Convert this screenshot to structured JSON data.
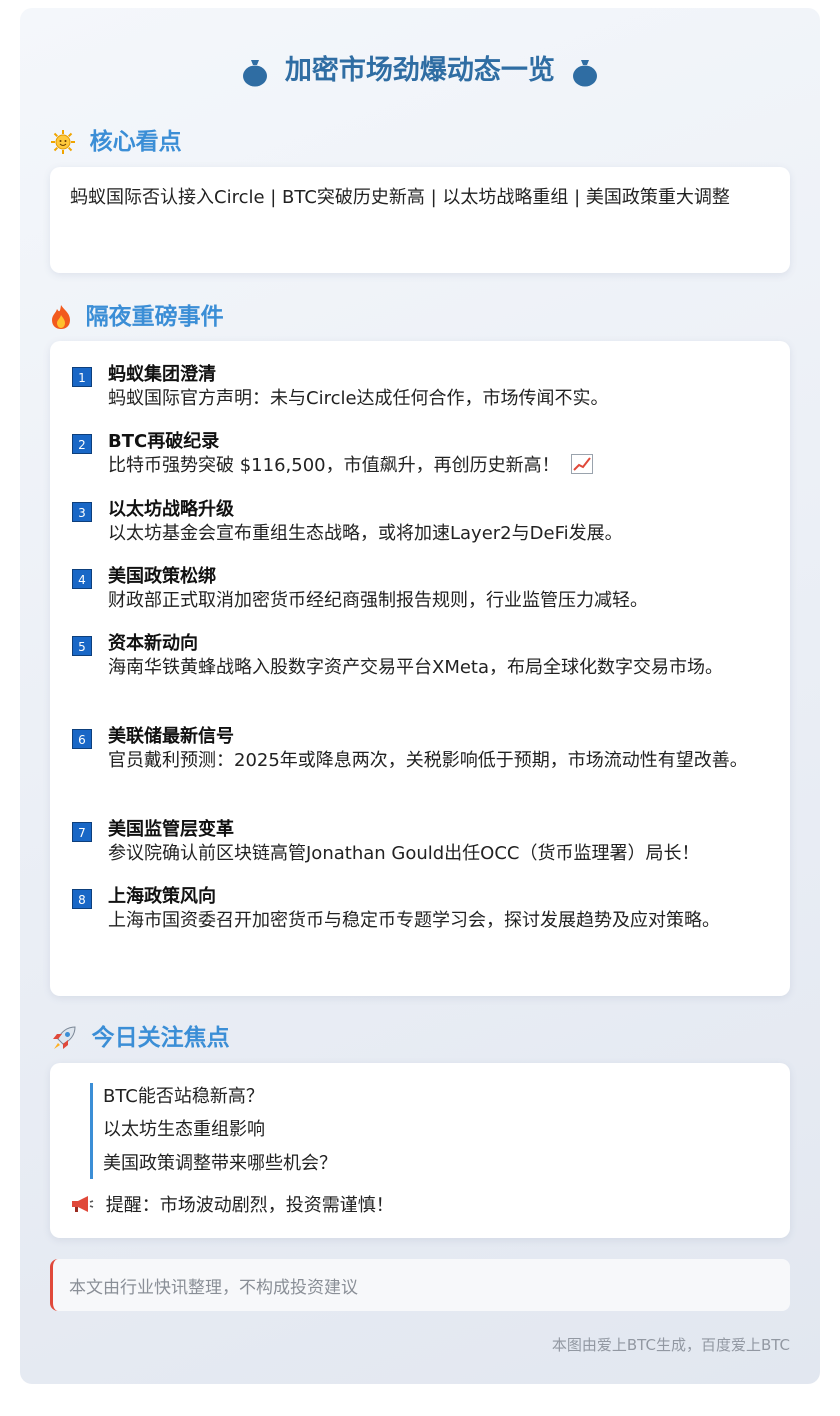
{
  "title": {
    "text": "加密市场劲爆动态一览",
    "left_icon": "money-bag-icon",
    "right_icon": "money-bag-icon"
  },
  "core": {
    "heading": "核心看点",
    "icon": "sun-icon",
    "text": "蚂蚁国际否认接入Circle | BTC突破历史新高 | 以太坊战略重组 | 美国政策重大调整"
  },
  "events": {
    "heading": "隔夜重磅事件",
    "icon": "fire-icon",
    "items": [
      {
        "num": "1",
        "title": "蚂蚁集团澄清",
        "desc": "蚂蚁国际官方声明：未与Circle达成任何合作，市场传闻不实。"
      },
      {
        "num": "2",
        "title": "BTC再破纪录",
        "desc": "比特币强势突破 $116,500，市值飙升，再创历史新高！",
        "icon": "chart-increasing-icon"
      },
      {
        "num": "3",
        "title": "以太坊战略升级",
        "desc": "以太坊基金会宣布重组生态战略，或将加速Layer2与DeFi发展。"
      },
      {
        "num": "4",
        "title": "美国政策松绑",
        "desc": "财政部正式取消加密货币经纪商强制报告规则，行业监管压力减轻。"
      },
      {
        "num": "5",
        "title": "资本新动向",
        "desc": "海南华铁黄蜂战略入股数字资产交易平台XMeta，布局全球化数字交易市场。"
      },
      {
        "num": "6",
        "title": "美联储最新信号",
        "desc": "官员戴利预测：2025年或降息两次，关税影响低于预期，市场流动性有望改善。"
      },
      {
        "num": "7",
        "title": "美国监管层变革",
        "desc": "参议院确认前区块链高管Jonathan Gould出任OCC（货币监理署）局长！"
      },
      {
        "num": "8",
        "title": "上海政策风向",
        "desc": "上海市国资委召开加密货币与稳定币专题学习会，探讨发展趋势及应对策略。"
      }
    ]
  },
  "focus": {
    "heading": "今日关注焦点",
    "icon": "rocket-icon",
    "items": [
      "BTC能否站稳新高？",
      "以太坊生态重组影响",
      "美国政策调整带来哪些机会？"
    ],
    "reminder": "提醒：市场波动剧烈，投资需谨慎！",
    "reminder_icon": "megaphone-icon"
  },
  "disclaimer": "本文由行业快讯整理，不构成投资建议",
  "footer": "本图由爱上BTC生成，百度爱上BTC",
  "colors": {
    "title": "#2f6da3",
    "heading": "#3b8ed6",
    "number_badge": "#1967c6",
    "disclaimer_accent": "#e0493a"
  }
}
